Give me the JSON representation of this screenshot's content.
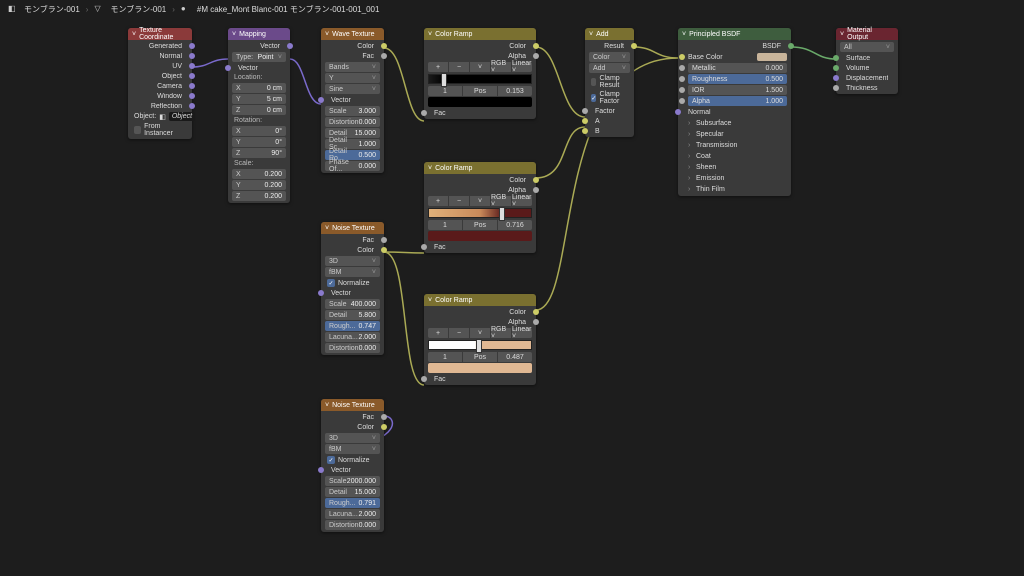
{
  "breadcrumb": {
    "item1": "モンブラン-001",
    "item2": "モンブラン-001",
    "item3": "#M cake_Mont Blanc-001 モンブラン-001-001_001"
  },
  "nodes": {
    "texcoord": {
      "title": "Texture Coordinate",
      "outs": [
        "Generated",
        "Normal",
        "UV",
        "Object",
        "Camera",
        "Window",
        "Reflection"
      ],
      "object_label": "Object:",
      "object_value": "Object",
      "from_instancer": "From Instancer"
    },
    "mapping": {
      "title": "Mapping",
      "out": "Vector",
      "type_label": "Type:",
      "type_value": "Point",
      "in_vector": "Vector",
      "location": "Location:",
      "loc": [
        [
          "X",
          "0 cm"
        ],
        [
          "Y",
          "5 cm"
        ],
        [
          "Z",
          "0 cm"
        ]
      ],
      "rotation": "Rotation:",
      "rot": [
        [
          "X",
          "0°"
        ],
        [
          "Y",
          "0°"
        ],
        [
          "Z",
          "90°"
        ]
      ],
      "scale": "Scale:",
      "scl": [
        [
          "X",
          "0.200"
        ],
        [
          "Y",
          "0.200"
        ],
        [
          "Z",
          "0.200"
        ]
      ]
    },
    "wave": {
      "title": "Wave Texture",
      "out_color": "Color",
      "out_fac": "Fac",
      "d1": "Bands",
      "d2": "Y",
      "d3": "Sine",
      "in_vector": "Vector",
      "props": [
        [
          "Scale",
          "3.000",
          false
        ],
        [
          "Distortion",
          "0.000",
          false
        ],
        [
          "Detail",
          "15.000",
          false
        ],
        [
          "Detail Sc...",
          "1.000",
          false
        ],
        [
          "Detail Ro...",
          "0.500",
          true
        ],
        [
          "Phase Of...",
          "0.000",
          false
        ]
      ]
    },
    "noise1": {
      "title": "Noise Texture",
      "out_fac": "Fac",
      "out_color": "Color",
      "d1": "3D",
      "d2": "fBM",
      "normalize": "Normalize",
      "in_vector": "Vector",
      "props": [
        [
          "Scale",
          "400.000",
          false
        ],
        [
          "Detail",
          "5.800",
          false
        ],
        [
          "Rough...",
          "0.747",
          true
        ],
        [
          "Lacuna...",
          "2.000",
          false
        ],
        [
          "Distortion",
          "0.000",
          false
        ]
      ]
    },
    "noise2": {
      "title": "Noise Texture",
      "out_fac": "Fac",
      "out_color": "Color",
      "d1": "3D",
      "d2": "fBM",
      "normalize": "Normalize",
      "in_vector": "Vector",
      "props": [
        [
          "Scale",
          "2000.000",
          false
        ],
        [
          "Detail",
          "15.000",
          false
        ],
        [
          "Rough...",
          "0.791",
          true
        ],
        [
          "Lacuna...",
          "2.000",
          false
        ],
        [
          "Distortion",
          "0.000",
          false
        ]
      ]
    },
    "ramp1": {
      "title": "Color Ramp",
      "out_color": "Color",
      "out_alpha": "Alpha",
      "mode_rgb": "RGB",
      "mode_int": "Linear",
      "stop_idx": "1",
      "pos_label": "Pos",
      "pos_val": "0.153",
      "in_fac": "Fac",
      "grad": "linear-gradient(to right,#1a1a1a 0%,#000 15%,#000 100%)",
      "handle": 15,
      "sw": "#000"
    },
    "ramp2": {
      "title": "Color Ramp",
      "out_color": "Color",
      "out_alpha": "Alpha",
      "mode_rgb": "RGB",
      "mode_int": "Linear",
      "stop_idx": "1",
      "pos_label": "Pos",
      "pos_val": "0.716",
      "in_fac": "Fac",
      "grad": "linear-gradient(to right,#e0b17a 0%,#c98a5a 50%,#5a1a1a 72%,#5a1a1a 100%)",
      "handle": 72,
      "sw": "#5a1a1a"
    },
    "ramp3": {
      "title": "Color Ramp",
      "out_color": "Color",
      "out_alpha": "Alpha",
      "mode_rgb": "RGB",
      "mode_int": "Linear",
      "stop_idx": "1",
      "pos_label": "Pos",
      "pos_val": "0.487",
      "in_fac": "Fac",
      "grad": "linear-gradient(to right,#ffffff 0%,#ffffff 45%,#e0b893 49%,#e0b893 100%)",
      "handle": 49,
      "sw": "#e0b893"
    },
    "add": {
      "title": "Add",
      "out": "Result",
      "in_color": "Color",
      "d1": "Add",
      "clamp_result": "Clamp Result",
      "clamp_factor": "Clamp Factor",
      "factor": "Factor",
      "a": "A",
      "b": "B"
    },
    "bsdf": {
      "title": "Principled BSDF",
      "out": "BSDF",
      "base_color": "Base Color",
      "rows": [
        [
          "Metallic",
          "0.000",
          false
        ],
        [
          "Roughness",
          "0.500",
          true
        ],
        [
          "IOR",
          "1.500",
          false
        ],
        [
          "Alpha",
          "1.000",
          true
        ]
      ],
      "normal": "Normal",
      "groups": [
        "Subsurface",
        "Specular",
        "Transmission",
        "Coat",
        "Sheen",
        "Emission",
        "Thin Film"
      ]
    },
    "output": {
      "title": "Material Output",
      "d1": "All",
      "ins": [
        "Surface",
        "Volume",
        "Displacement",
        "Thickness"
      ]
    }
  }
}
